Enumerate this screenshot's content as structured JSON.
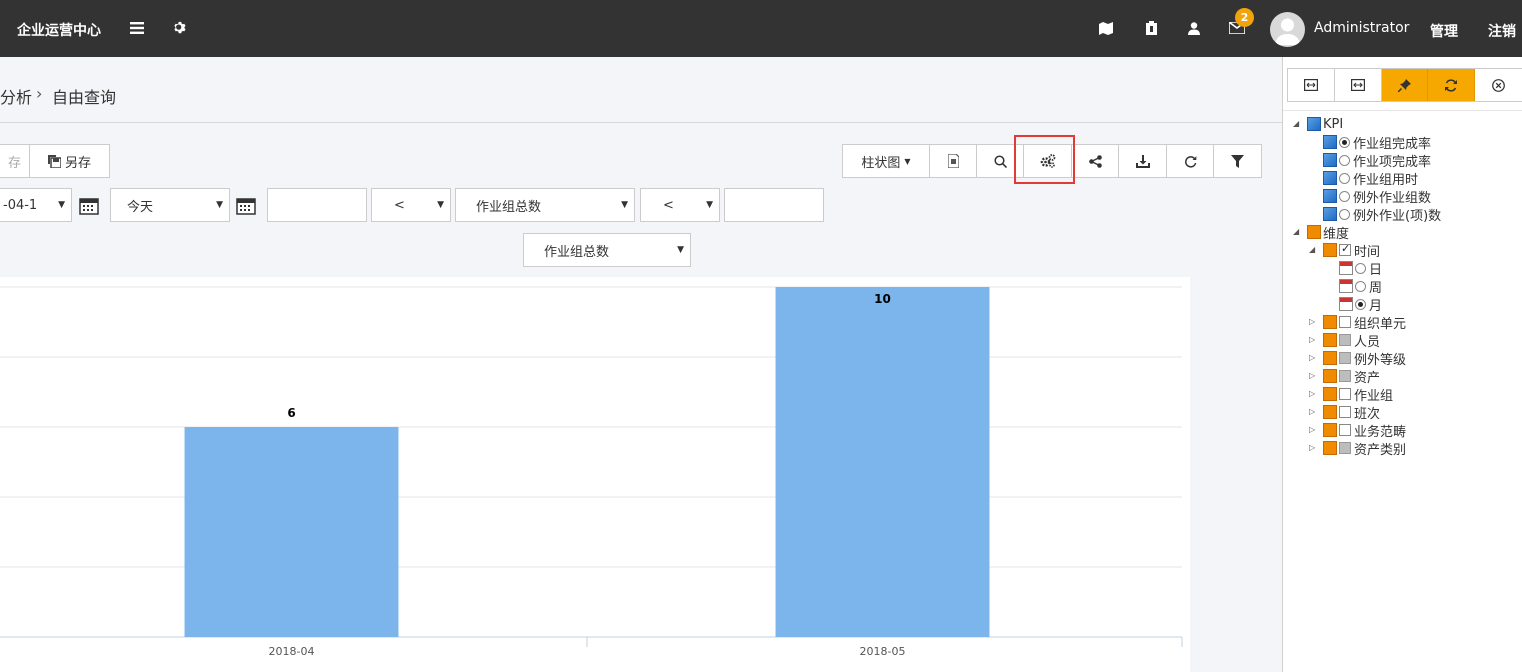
{
  "topbar": {
    "brand": "企业运营中心",
    "notification_count": "2",
    "username": "Administrator",
    "manage_label": "管理",
    "logout_label": "注销"
  },
  "breadcrumb": {
    "parent": "分析",
    "current": "自由查询"
  },
  "toolbar": {
    "save_label": "存",
    "saveas_label": "另存",
    "chart_type_label": "柱状图"
  },
  "filters": {
    "date_value": "-04-1",
    "period_value": "今天",
    "text_value": "",
    "op1_value": "<",
    "metric_value": "作业组总数",
    "op2_value": "<",
    "value2": "",
    "sort_metric_value": "作业组总数"
  },
  "chart_data": {
    "type": "bar",
    "categories": [
      "2018-04",
      "2018-05"
    ],
    "values": [
      6,
      10
    ],
    "data_labels": [
      "6",
      "10"
    ],
    "title": "",
    "xlabel": "",
    "ylabel": "",
    "ylim": [
      0,
      10
    ],
    "grid": true,
    "bar_color": "#7cb5ec"
  },
  "panel": {
    "tree": [
      {
        "label": "KPI",
        "level": 0,
        "expand": "open",
        "icon": "kpi-icon"
      },
      {
        "label": "作业组完成率",
        "level": 1,
        "icon": "kpi-icon",
        "radio": true,
        "selected": true
      },
      {
        "label": "作业项完成率",
        "level": 1,
        "icon": "kpi-icon",
        "radio": true,
        "selected": false
      },
      {
        "label": "作业组用时",
        "level": 1,
        "icon": "kpi-icon",
        "radio": true,
        "selected": false
      },
      {
        "label": "例外作业组数",
        "level": 1,
        "icon": "kpi-icon",
        "radio": true,
        "selected": false
      },
      {
        "label": "例外作业(项)数",
        "level": 1,
        "icon": "kpi-icon",
        "radio": true,
        "selected": false
      },
      {
        "label": "维度",
        "level": 0,
        "expand": "open",
        "icon": "dimension-icon"
      },
      {
        "label": "时间",
        "level": 1,
        "expand": "open",
        "icon": "dimension-icon",
        "checked": true
      },
      {
        "label": "日",
        "level": 2,
        "icon": "calendar-icon",
        "radio": true,
        "selected": false
      },
      {
        "label": "周",
        "level": 2,
        "icon": "calendar-icon",
        "radio": true,
        "selected": false
      },
      {
        "label": "月",
        "level": 2,
        "icon": "calendar-icon",
        "radio": true,
        "selected": true
      },
      {
        "label": "组织单元",
        "level": 1,
        "expand": "closed",
        "icon": "dimension-icon",
        "checked": false
      },
      {
        "label": "人员",
        "level": 1,
        "expand": "closed",
        "icon": "dimension-icon",
        "checked": false,
        "grey": true
      },
      {
        "label": "例外等级",
        "level": 1,
        "expand": "closed",
        "icon": "dimension-icon",
        "checked": false,
        "grey": true
      },
      {
        "label": "资产",
        "level": 1,
        "expand": "closed",
        "icon": "dimension-icon",
        "checked": false,
        "grey": true
      },
      {
        "label": "作业组",
        "level": 1,
        "expand": "closed",
        "icon": "dimension-icon",
        "checked": false
      },
      {
        "label": "班次",
        "level": 1,
        "expand": "closed",
        "icon": "dimension-icon",
        "checked": false
      },
      {
        "label": "业务范畴",
        "level": 1,
        "expand": "closed",
        "icon": "dimension-icon",
        "checked": false
      },
      {
        "label": "资产类别",
        "level": 1,
        "expand": "closed",
        "icon": "dimension-icon",
        "checked": false,
        "grey": true
      }
    ]
  }
}
